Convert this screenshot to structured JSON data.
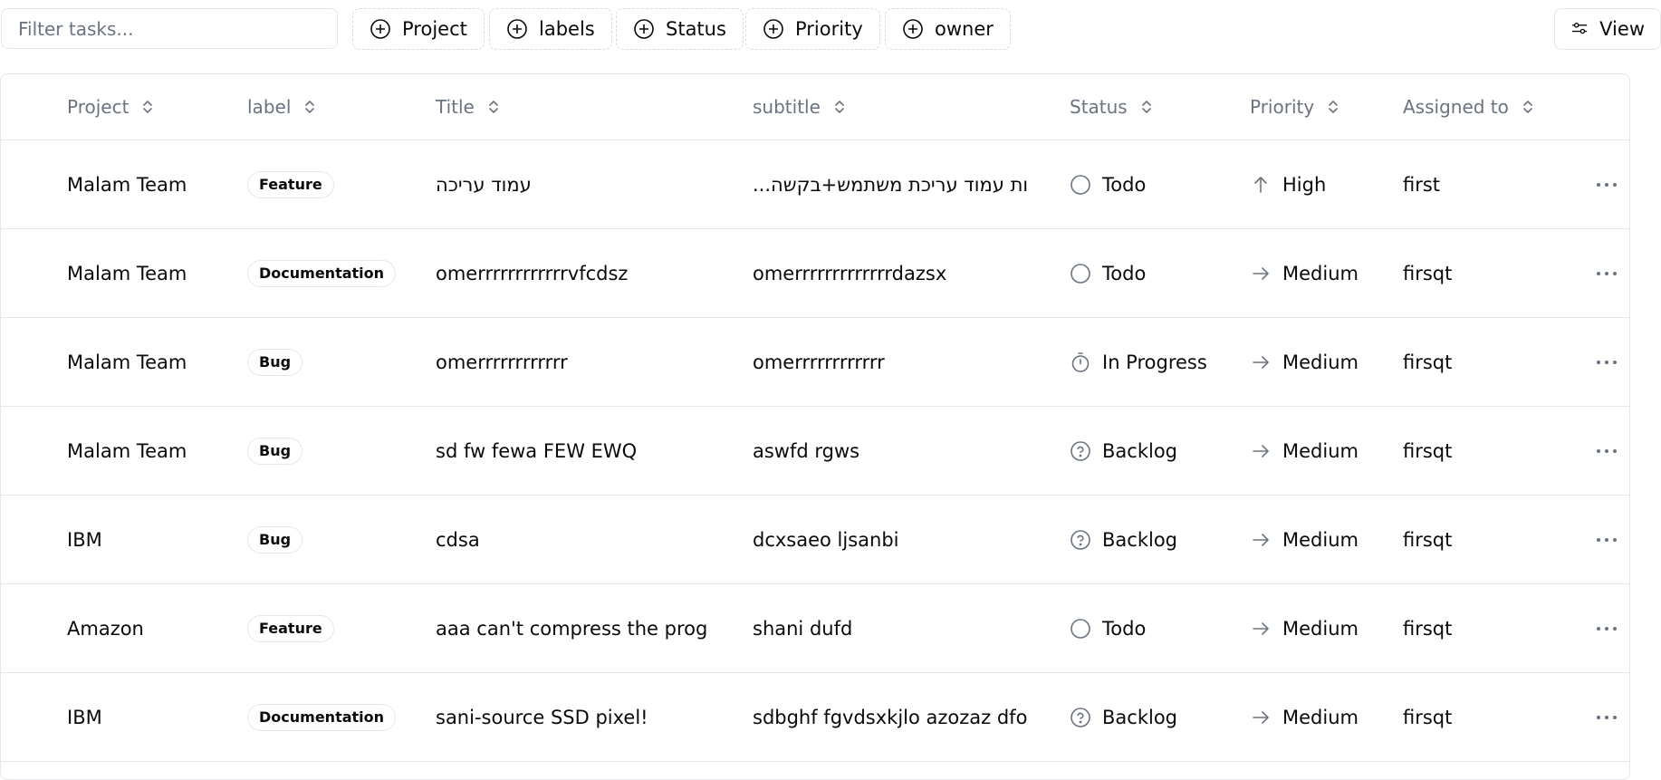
{
  "toolbar": {
    "filter_placeholder": "Filter tasks...",
    "filters": [
      "Project",
      "labels",
      "Status",
      "Priority",
      "owner"
    ],
    "view_label": "View"
  },
  "table": {
    "columns": [
      "Project",
      "label",
      "Title",
      "subtitle",
      "Status",
      "Priority",
      "Assigned to"
    ],
    "rows": [
      {
        "project": "Malam Team",
        "label": "Feature",
        "title": "עמוד עריכה",
        "subtitle": "...ות עמוד עריכת משתמש+בקשה",
        "status": "Todo",
        "status_icon": "circle-icon",
        "priority": "High",
        "priority_icon": "arrow-up-icon",
        "assigned": "first"
      },
      {
        "project": "Malam Team",
        "label": "Documentation",
        "title": "omerrrrrrrrrrrrvfcdsz",
        "subtitle": "omerrrrrrrrrrrrrdazsx",
        "status": "Todo",
        "status_icon": "circle-icon",
        "priority": "Medium",
        "priority_icon": "arrow-right-icon",
        "assigned": "firsqt"
      },
      {
        "project": "Malam Team",
        "label": "Bug",
        "title": "omerrrrrrrrrrrr",
        "subtitle": "omerrrrrrrrrrrr",
        "status": "In Progress",
        "status_icon": "timer-icon",
        "priority": "Medium",
        "priority_icon": "arrow-right-icon",
        "assigned": "firsqt"
      },
      {
        "project": "Malam Team",
        "label": "Bug",
        "title": "sd fw fewa FEW EWQ",
        "subtitle": "aswfd rgws",
        "status": "Backlog",
        "status_icon": "question-circle-icon",
        "priority": "Medium",
        "priority_icon": "arrow-right-icon",
        "assigned": "firsqt"
      },
      {
        "project": "IBM",
        "label": "Bug",
        "title": "cdsa",
        "subtitle": "dcxsaeo ljsanbi",
        "status": "Backlog",
        "status_icon": "question-circle-icon",
        "priority": "Medium",
        "priority_icon": "arrow-right-icon",
        "assigned": "firsqt"
      },
      {
        "project": "Amazon",
        "label": "Feature",
        "title": "aaa can't compress the progra...",
        "subtitle": "shani dufd",
        "status": "Todo",
        "status_icon": "circle-icon",
        "priority": "Medium",
        "priority_icon": "arrow-right-icon",
        "assigned": "firsqt"
      },
      {
        "project": "IBM",
        "label": "Documentation",
        "title": "sani-source SSD pixel!",
        "subtitle": "sdbghf fgvdsxkjlo azozaz dfo",
        "status": "Backlog",
        "status_icon": "question-circle-icon",
        "priority": "Medium",
        "priority_icon": "arrow-right-icon",
        "assigned": "firsqt"
      }
    ]
  },
  "colors": {
    "border": "#e5e7eb",
    "muted_text": "#6b7280",
    "text": "#0a0a0a"
  }
}
